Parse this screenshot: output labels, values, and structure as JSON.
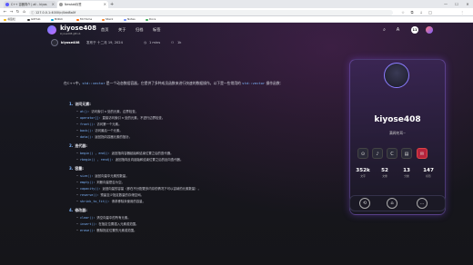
{
  "browser": {
    "tabs": [
      {
        "label": "C++ 容器简介 | ali - kiyos"
      },
      {
        "label": "Newtab标签"
      }
    ],
    "new_tab": "+",
    "window_controls": [
      "—",
      "☐",
      "✕"
    ],
    "url": "127.0.0.1:4000/c/0dd8a0f"
  },
  "bookmarks": [
    {
      "label": "书签栏",
      "color": "#f4b400"
    },
    {
      "label": "GitHub",
      "color": "#333333"
    },
    {
      "label": "Bilibili",
      "color": "#00a1d6"
    },
    {
      "label": "Mi Home",
      "color": "#ff6700"
    },
    {
      "label": "Stack",
      "color": "#f48024"
    },
    {
      "label": "Notes",
      "color": "#6b8cff"
    },
    {
      "label": "Docs",
      "color": "#34a853"
    }
  ],
  "site": {
    "title": "kiyose408",
    "subtitle": "kiyose408.github",
    "nav": [
      "首页",
      "关于",
      "归档",
      "标签"
    ],
    "nav_icons": [
      "search-icon",
      "translate-icon",
      "theme-icon"
    ],
    "badge": "11"
  },
  "post": {
    "author": "kiyose408",
    "date": "发布于 十二月 19, 2024",
    "read_time": "1 mins",
    "views": "1k"
  },
  "article": {
    "intro_a": "在C++中，",
    "intro_code1": "std::vector",
    "intro_b": "是一个动态数组容器，它提供了多种成员函数来进行快速的数据操作。以下是一些常用的",
    "intro_code2": "std::vector",
    "intro_c": "操作函数：",
    "sections": [
      {
        "num": "1.",
        "title": "访问元素:",
        "items": [
          {
            "code": "at():",
            "text": "访问索引 n 处的元素，边界检查。"
          },
          {
            "code": "operator[]:",
            "text": "直接访问索引 n 处的元素，不进行边界检查。"
          },
          {
            "code": "front():",
            "text": "访问第一个元素。"
          },
          {
            "code": "back():",
            "text": "访问最后一个元素。"
          },
          {
            "code": "data():",
            "text": "返回指向容器元素的指针。"
          }
        ]
      },
      {
        "num": "2.",
        "title": "迭代器:",
        "items": [
          {
            "code": "begin() , end():",
            "text": "返回指向容器起始和结束位置之后的迭代器。"
          },
          {
            "code": "rbegin() , rend():",
            "text": "返回指向反向起始和结束位置之后的反向迭代器。"
          }
        ]
      },
      {
        "num": "3.",
        "title": "容量:",
        "items": [
          {
            "code": "size():",
            "text": "返回向量中元素的数量。"
          },
          {
            "code": "empty():",
            "text": "判断向量是否为空。"
          },
          {
            "code": "capacity():",
            "text": "返回向量的容量（即在不分配更多内存的情况下可以容纳的元素数量）。"
          },
          {
            "code": "reserve():",
            "text": "预留至少指定数量的存储空间。"
          },
          {
            "code": "shrink_to_fit():",
            "text": "请求移除未使用的容量。"
          }
        ]
      },
      {
        "num": "4.",
        "title": "修改器:",
        "items": [
          {
            "code": "clear():",
            "text": "清空向量中的所有元素。"
          },
          {
            "code": "insert():",
            "text": "在指定位置插入元素或范围。"
          },
          {
            "code": "erase():",
            "text": "删除指定位置的元素或范围。"
          }
        ]
      }
    ]
  },
  "profile": {
    "name": "kiyose408",
    "bio": "满闻何耳~",
    "socials": [
      "github-icon",
      "music-icon",
      "csdn-icon",
      "rss-icon",
      "mail-icon"
    ],
    "socials_glyphs": [
      "⊙",
      "♪",
      "C",
      "▤",
      "✉"
    ],
    "stats": [
      {
        "value": "352k",
        "label": "文字"
      },
      {
        "value": "52",
        "label": "文章"
      },
      {
        "value": "13",
        "label": "分类"
      },
      {
        "value": "147",
        "label": "标签"
      }
    ],
    "actions": [
      "back-icon",
      "home-icon",
      "comment-icon"
    ],
    "action_glyphs": [
      "⟲",
      "⌂",
      "…"
    ]
  },
  "colors": {
    "accent": "#7fb7ff",
    "brand": "#8b7dff"
  }
}
